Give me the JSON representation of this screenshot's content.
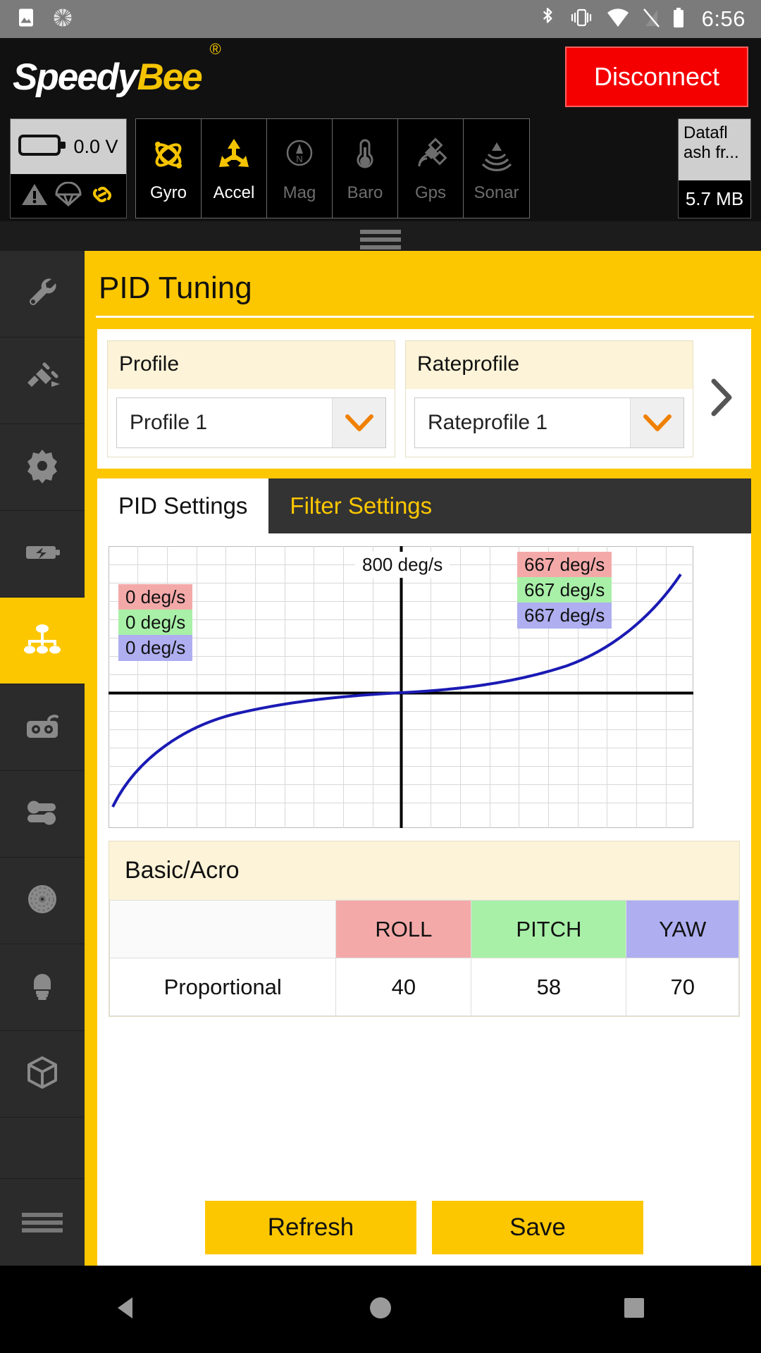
{
  "statusbar": {
    "time": "6:56",
    "icons_left": [
      "image-icon",
      "circle-progress-icon"
    ],
    "icons_right": [
      "bluetooth-icon",
      "vibrate-icon",
      "wifi-icon",
      "signal-off-icon",
      "battery-icon"
    ]
  },
  "header": {
    "logo_first": "Speedy",
    "logo_second": "Bee",
    "logo_reg": "®",
    "disconnect_label": "Disconnect"
  },
  "telemetry": {
    "battery_voltage": "0.0 V",
    "status_icons": [
      {
        "name": "warning-icon",
        "active": false
      },
      {
        "name": "parachute-icon",
        "active": false
      },
      {
        "name": "link-icon",
        "active": true
      }
    ],
    "sensors": [
      {
        "label": "Gyro",
        "icon": "gyro-icon",
        "active": true
      },
      {
        "label": "Accel",
        "icon": "accel-icon",
        "active": true
      },
      {
        "label": "Mag",
        "icon": "compass-icon",
        "active": false
      },
      {
        "label": "Baro",
        "icon": "thermometer-icon",
        "active": false
      },
      {
        "label": "Gps",
        "icon": "satellite-icon",
        "active": false
      },
      {
        "label": "Sonar",
        "icon": "sonar-icon",
        "active": false
      }
    ],
    "dataflash": {
      "label": "Datafl ash fr...",
      "value": "5.7 MB"
    }
  },
  "sidebar": {
    "items": [
      {
        "name": "sidebar-item-setup",
        "icon": "wrench-icon",
        "active": false
      },
      {
        "name": "sidebar-item-ports",
        "icon": "plug-icon",
        "active": false
      },
      {
        "name": "sidebar-item-configuration",
        "icon": "gear-icon",
        "active": false
      },
      {
        "name": "sidebar-item-power",
        "icon": "battery-bolt-icon",
        "active": false
      },
      {
        "name": "sidebar-item-pid-tuning",
        "icon": "pid-hierarchy-icon",
        "active": true
      },
      {
        "name": "sidebar-item-receiver",
        "icon": "gamepad-icon",
        "active": false
      },
      {
        "name": "sidebar-item-modes",
        "icon": "toggles-icon",
        "active": false
      },
      {
        "name": "sidebar-item-motors",
        "icon": "propeller-icon",
        "active": false
      },
      {
        "name": "sidebar-item-led",
        "icon": "led-icon",
        "active": false
      },
      {
        "name": "sidebar-item-osd",
        "icon": "cube-icon",
        "active": false
      }
    ],
    "menu_icon": "hamburger-icon"
  },
  "page": {
    "title": "PID Tuning",
    "profile": {
      "header": "Profile",
      "selected": "Profile 1",
      "chevron": "chevron-down-icon"
    },
    "rateprofile": {
      "header": "Rateprofile",
      "selected": "Rateprofile 1",
      "chevron": "chevron-down-icon"
    },
    "next_arrow": "chevron-right-icon",
    "tabs": [
      {
        "label": "PID Settings",
        "active": true
      },
      {
        "label": "Filter Settings",
        "active": false
      }
    ],
    "footer": {
      "refresh_label": "Refresh",
      "save_label": "Save"
    }
  },
  "chart_data": {
    "type": "line",
    "title": "",
    "xlabel": "",
    "ylabel": "",
    "grid": true,
    "legend_position": "inline-labels",
    "annotations": {
      "top_center": "800 deg/s",
      "left": [
        {
          "text": "0 deg/s",
          "axis": "roll",
          "color": "#f4a9a9"
        },
        {
          "text": "0 deg/s",
          "axis": "pitch",
          "color": "#a8f0a8"
        },
        {
          "text": "0 deg/s",
          "axis": "yaw",
          "color": "#aeaef0"
        }
      ],
      "right": [
        {
          "text": "667 deg/s",
          "axis": "roll",
          "color": "#f4a9a9"
        },
        {
          "text": "667 deg/s",
          "axis": "pitch",
          "color": "#a8f0a8"
        },
        {
          "text": "667 deg/s",
          "axis": "yaw",
          "color": "#aeaef0"
        }
      ]
    },
    "series": [
      {
        "name": "rate-curve",
        "color": "#1a1ab4",
        "x": [
          -1.0,
          -0.9,
          -0.8,
          -0.7,
          -0.6,
          -0.5,
          -0.4,
          -0.3,
          -0.2,
          -0.1,
          0.0,
          0.1,
          0.2,
          0.3,
          0.4,
          0.5,
          0.6,
          0.7,
          0.8,
          0.9,
          1.0
        ],
        "y": [
          -667,
          -520,
          -420,
          -345,
          -285,
          -232,
          -184,
          -139,
          -94,
          -48,
          0,
          48,
          94,
          139,
          184,
          232,
          285,
          345,
          420,
          520,
          667
        ]
      }
    ],
    "xlim": [
      -1.0,
      1.0
    ],
    "ylim": [
      -800,
      800
    ]
  },
  "acro_table": {
    "title": "Basic/Acro",
    "columns": [
      "",
      "ROLL",
      "PITCH",
      "YAW"
    ],
    "rows": [
      {
        "label": "Proportional",
        "roll": "40",
        "pitch": "58",
        "yaw": "70"
      }
    ]
  },
  "navbar": {
    "back": "back-triangle-icon",
    "home": "home-circle-icon",
    "recents": "recents-square-icon"
  },
  "colors": {
    "brand_yellow": "#fdc700",
    "danger_red": "#f50000",
    "roll": "#f4a9a9",
    "pitch": "#a8f0a8",
    "yaw": "#aeaef0",
    "curve": "#1a1ab4"
  }
}
